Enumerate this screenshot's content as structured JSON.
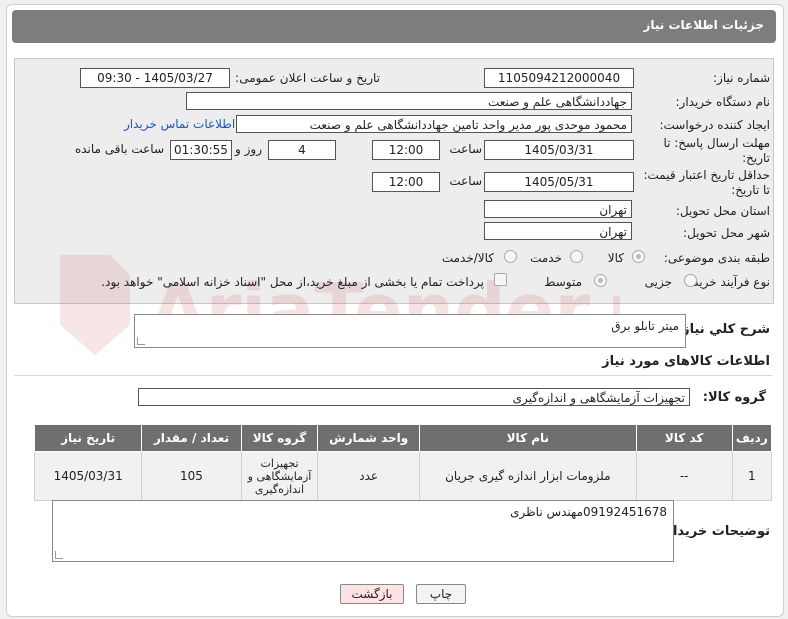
{
  "header": {
    "title": "جزئیات اطلاعات نیاز"
  },
  "labels": {
    "need_number": "شماره نیاز:",
    "announce_datetime": "تاریخ و ساعت اعلان عمومی:",
    "buyer_org": "نام دستگاه خریدار:",
    "requester": "ایجاد کننده درخواست:",
    "reply_deadline": "مهلت ارسال پاسخ: تا تاریخ:",
    "price_validity": "حداقل تاریخ اعتبار قیمت: تا تاریخ:",
    "hour": "ساعت",
    "day_and": "روز و",
    "remaining": "ساعت باقی مانده",
    "province": "استان محل تحویل:",
    "city": "شهر محل تحویل:",
    "category": "طبقه بندی موضوعی:",
    "process_type": "نوع فرآیند خرید :"
  },
  "values": {
    "need_number": "1105094212000040",
    "announce_datetime": "1405/03/27 - 09:30",
    "buyer_org": "جهاددانشگاهی علم و صنعت",
    "requester": "محمود موحدی پور مدیر واحد تامین جهاددانشگاهی علم و صنعت",
    "contact_link": "اطلاعات تماس خریدار",
    "reply_date": "1405/03/31",
    "reply_time": "12:00",
    "reply_days": "4",
    "reply_remaining": "01:30:55",
    "price_date": "1405/05/31",
    "price_time": "12:00",
    "province": "تهران",
    "city": "تهران"
  },
  "category_options": [
    "کالا",
    "خدمت",
    "کالا/خدمت"
  ],
  "process_options": [
    "جزیی",
    "متوسط"
  ],
  "payment_note": "پرداخت تمام یا بخشی از مبلغ خرید،از محل \"اسناد خزانه اسلامی\" خواهد بود.",
  "description": {
    "label": "شرح کلي نياز:",
    "value": "میتر تابلو برق"
  },
  "goods_info_title": "اطلاعات کالاهای مورد نیاز",
  "goods_group": {
    "label": "گروه کالا:",
    "value": "تجهیزات آزمایشگاهی و اندازه‌گیری"
  },
  "table": {
    "headers": [
      "ردیف",
      "کد کالا",
      "نام کالا",
      "واحد شمارش",
      "گروه کالا",
      "تعداد / مقدار",
      "تاریخ نیاز"
    ],
    "rows": [
      [
        "1",
        "--",
        "ملزومات ابزار اندازه گیری جریان",
        "عدد",
        "تجهیزات آزمایشگاهی و اندازه‌گیری",
        "105",
        "1405/03/31"
      ]
    ]
  },
  "buyer_notes": {
    "label": "توضیحات خریدار:",
    "value": "09192451678مهندس ناظری"
  },
  "buttons": {
    "print": "چاپ",
    "back": "بازگشت"
  },
  "watermark_text": "AriaTender.neT",
  "colors": {
    "header_bg": "#7d7d7d",
    "table_header_bg": "#6f6f6f",
    "link": "#1a56c4",
    "back_btn_bg": "#fde3e3",
    "print_btn_bg": "#f4f4f4"
  }
}
